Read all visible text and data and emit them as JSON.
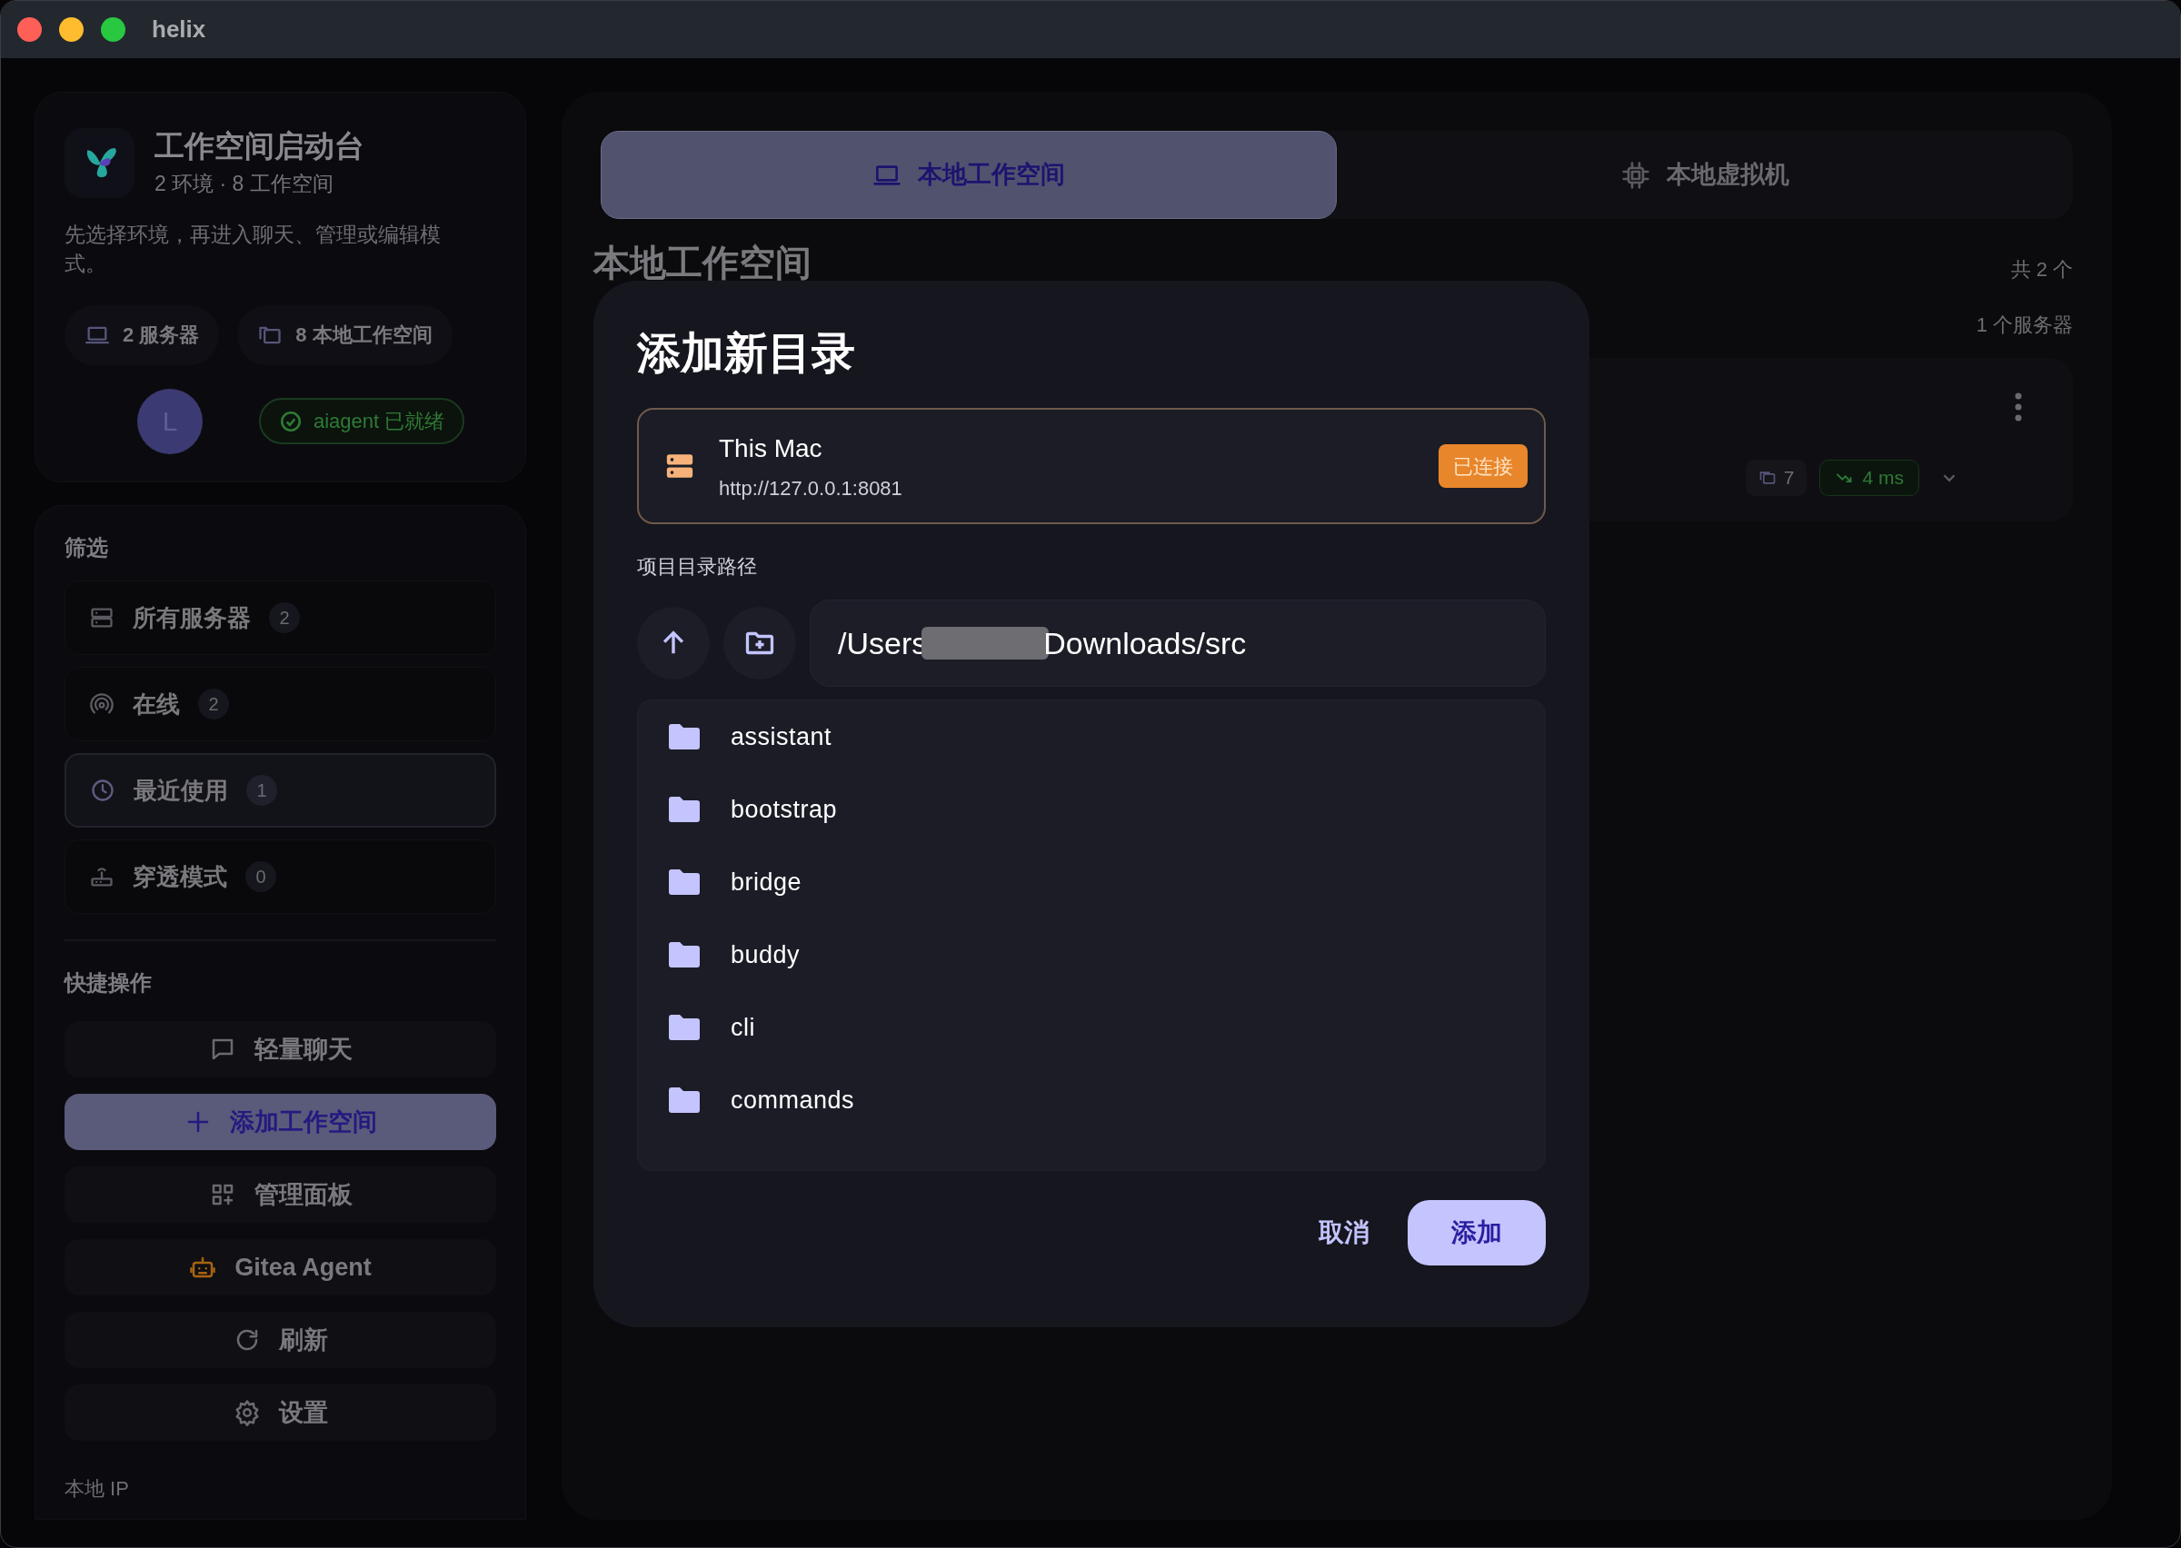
{
  "window": {
    "title": "helix"
  },
  "sidebar": {
    "header": {
      "title": "工作空间启动台",
      "subtitle": "2 环境 · 8 工作空间",
      "description": "先选择环境，再进入聊天、管理或编辑模式。",
      "chips": [
        "2 服务器",
        "8 本地工作空间"
      ],
      "avatar": "L",
      "status": "aiagent 已就绪"
    },
    "filter": {
      "title": "筛选",
      "items": [
        {
          "label": "所有服务器",
          "count": "2",
          "selected": false
        },
        {
          "label": "在线",
          "count": "2",
          "selected": false
        },
        {
          "label": "最近使用",
          "count": "1",
          "selected": true
        },
        {
          "label": "穿透模式",
          "count": "0",
          "selected": false
        }
      ]
    },
    "quick_actions": {
      "title": "快捷操作",
      "items": [
        {
          "label": "轻量聊天",
          "primary": false
        },
        {
          "label": "添加工作空间",
          "primary": true
        },
        {
          "label": "管理面板",
          "primary": false
        },
        {
          "label": "Gitea Agent",
          "primary": false
        },
        {
          "label": "刷新",
          "primary": false
        },
        {
          "label": "设置",
          "primary": false
        }
      ]
    },
    "local_ip_label": "本地 IP"
  },
  "main": {
    "tabs": [
      {
        "label": "本地工作空间",
        "selected": true
      },
      {
        "label": "本地虚拟机",
        "selected": false
      }
    ],
    "heading": "本地工作空间",
    "total": "共 2 个",
    "server_count": "1 个服务器",
    "server_card": {
      "workspaces": "7",
      "latency": "4 ms"
    }
  },
  "dialog": {
    "title": "添加新目录",
    "server": {
      "name": "This Mac",
      "url": "http://127.0.0.1:8081",
      "status": "已连接"
    },
    "path_label": "项目目录路径",
    "path": {
      "start": "/Users",
      "end": "Downloads/src"
    },
    "folders": [
      "assistant",
      "bootstrap",
      "bridge",
      "buddy",
      "cli",
      "commands"
    ],
    "buttons": {
      "cancel": "取消",
      "confirm": "添加"
    }
  }
}
